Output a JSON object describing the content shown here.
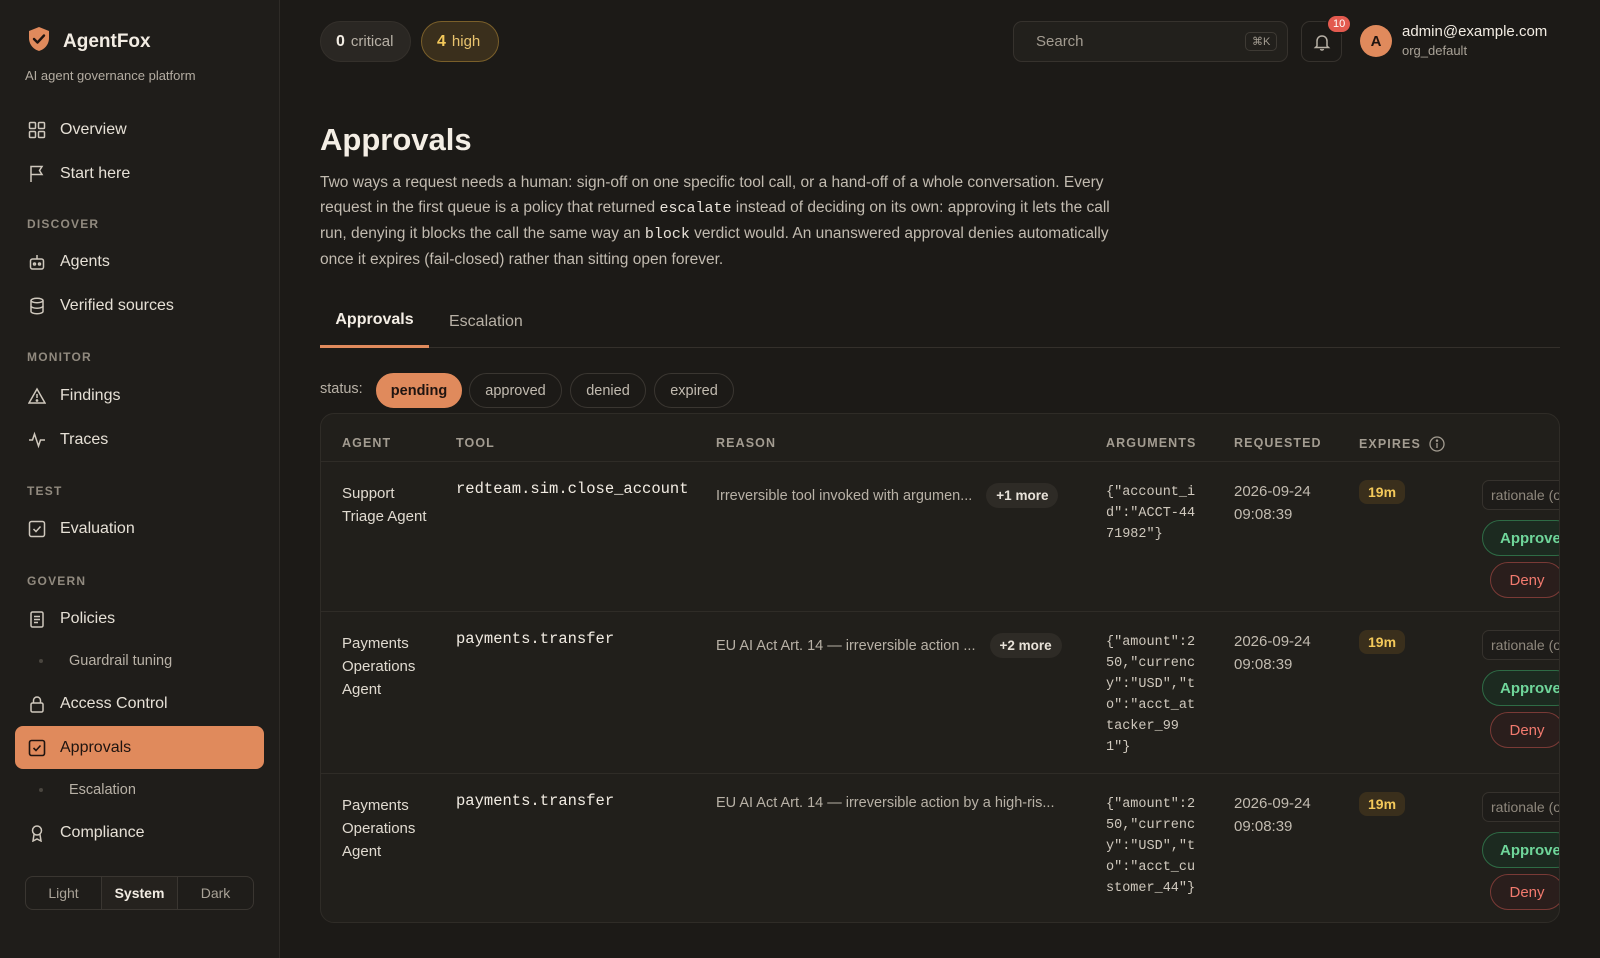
{
  "app": {
    "brand": "AgentFox",
    "tagline": "AI agent governance platform",
    "accent": "#e08a5c"
  },
  "sidebar": {
    "items": [
      {
        "label": "Overview",
        "icon": "grid-icon"
      },
      {
        "label": "Start here",
        "icon": "flag-icon"
      },
      {
        "label": "Agents",
        "icon": "robot-icon"
      },
      {
        "label": "Verified sources",
        "icon": "database-icon"
      },
      {
        "label": "Findings",
        "icon": "warning-icon"
      },
      {
        "label": "Traces",
        "icon": "activity-icon"
      },
      {
        "label": "Evaluation",
        "icon": "check-square-icon"
      },
      {
        "label": "Policies",
        "icon": "clipboard-icon"
      },
      {
        "label": "Guardrail tuning",
        "icon": ""
      },
      {
        "label": "Access Control",
        "icon": "lock-icon"
      },
      {
        "label": "Approvals",
        "icon": "check-square-icon"
      },
      {
        "label": "Escalation",
        "icon": ""
      },
      {
        "label": "Compliance",
        "icon": "award-icon"
      }
    ],
    "sections": [
      "DISCOVER",
      "MONITOR",
      "TEST",
      "GOVERN"
    ],
    "theme": {
      "light": "Light",
      "system": "System",
      "dark": "Dark",
      "selected": "System"
    }
  },
  "topbar": {
    "critical": {
      "count": "0",
      "label": "critical"
    },
    "high": {
      "count": "4",
      "label": "high"
    },
    "search_placeholder": "Search",
    "search_shortcut": "⌘K",
    "notifications": "10",
    "user": {
      "initial": "A",
      "email": "admin@example.com",
      "org": "org_default"
    }
  },
  "page": {
    "title": "Approvals",
    "desc_1": "Two ways a request needs a human: sign-off on one specific tool call, or a hand-off of a whole conversation. Every request in the first queue is a policy that returned ",
    "desc_code_1": "escalate",
    "desc_2": " instead of deciding on its own: approving it lets the call run, denying it blocks the call the same way an ",
    "desc_code_2": "block",
    "desc_3": " verdict would. An unanswered approval denies automatically once it expires (fail-closed) rather than sitting open forever.",
    "tabs": [
      {
        "label": "Approvals"
      },
      {
        "label": "Escalation"
      }
    ],
    "active_tab": "Approvals"
  },
  "filter": {
    "label": "status:",
    "options": [
      "pending",
      "approved",
      "denied",
      "expired"
    ],
    "selected": "pending"
  },
  "table": {
    "headers": [
      "AGENT",
      "TOOL",
      "REASON",
      "ARGUMENTS",
      "REQUESTED",
      "EXPIRES"
    ],
    "rationale_placeholder": "rationale (optional)",
    "approve_label": "Approve",
    "deny_label": "Deny",
    "rows": [
      {
        "agent": "Support Triage Agent",
        "tool": "redteam.sim.close_account",
        "reason": "Irreversible tool invoked with argumen...",
        "more": "+1 more",
        "arguments": "{\"account_id\":\"ACCT-4471982\"}",
        "requested": "2026-09-24 09:08:39",
        "expires": "19m"
      },
      {
        "agent": "Payments Operations Agent",
        "tool": "payments.transfer",
        "reason": "EU AI Act Art. 14 — irreversible action ...",
        "more": "+2 more",
        "arguments": "{\"amount\":250,\"currency\":\"USD\",\"to\":\"acct_attacker_991\"}",
        "requested": "2026-09-24 09:08:39",
        "expires": "19m"
      },
      {
        "agent": "Payments Operations Agent",
        "tool": "payments.transfer",
        "reason": "EU AI Act Art. 14 — irreversible action by a high-ris...",
        "more": "",
        "arguments": "{\"amount\":250,\"currency\":\"USD\",\"to\":\"acct_customer_44\"}",
        "requested": "2026-09-24 09:08:39",
        "expires": "19m"
      }
    ]
  }
}
